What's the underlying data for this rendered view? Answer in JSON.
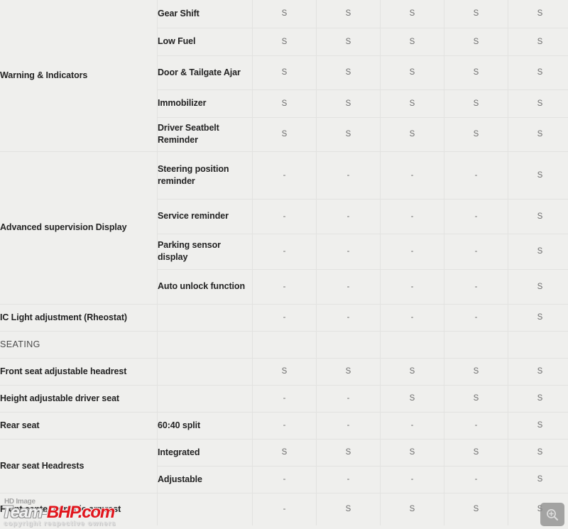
{
  "table": {
    "columns": [
      "feature-group",
      "feature-detail",
      "variant-1",
      "variant-2",
      "variant-3",
      "variant-4",
      "variant-5"
    ],
    "rows": [
      {
        "type": "data",
        "group": "Warning & Indicators",
        "group_rowspan": 5,
        "sub": "Gear Shift",
        "values": [
          "S",
          "S",
          "S",
          "S",
          "S"
        ]
      },
      {
        "type": "data",
        "group": null,
        "sub": "Low Fuel",
        "values": [
          "S",
          "S",
          "S",
          "S",
          "S"
        ]
      },
      {
        "type": "data",
        "group": null,
        "sub": "Door & Tailgate Ajar",
        "values": [
          "S",
          "S",
          "S",
          "S",
          "S"
        ]
      },
      {
        "type": "data",
        "group": null,
        "sub": "Immobilizer",
        "values": [
          "S",
          "S",
          "S",
          "S",
          "S"
        ]
      },
      {
        "type": "data",
        "group": null,
        "sub": "Driver Seatbelt Reminder",
        "values": [
          "S",
          "S",
          "S",
          "S",
          "S"
        ]
      },
      {
        "type": "data",
        "group": "Advanced supervision Display",
        "group_rowspan": 4,
        "sub": "Steering position reminder",
        "values": [
          "-",
          "-",
          "-",
          "-",
          "S"
        ]
      },
      {
        "type": "data",
        "group": null,
        "sub": "Service reminder",
        "values": [
          "-",
          "-",
          "-",
          "-",
          "S"
        ]
      },
      {
        "type": "data",
        "group": null,
        "sub": "Parking sensor display",
        "values": [
          "-",
          "-",
          "-",
          "-",
          "S"
        ]
      },
      {
        "type": "data",
        "group": null,
        "sub": "Auto unlock function",
        "values": [
          "-",
          "-",
          "-",
          "-",
          "S"
        ]
      },
      {
        "type": "data",
        "group": "IC Light adjustment (Rheostat)",
        "group_rowspan": 1,
        "sub": "",
        "values": [
          "-",
          "-",
          "-",
          "-",
          "S"
        ]
      },
      {
        "type": "section",
        "group": "SEATING",
        "sub": "",
        "values": [
          "",
          "",
          "",
          "",
          ""
        ]
      },
      {
        "type": "data",
        "group": "Front seat adjustable headrest",
        "group_rowspan": 1,
        "sub": "",
        "values": [
          "S",
          "S",
          "S",
          "S",
          "S"
        ]
      },
      {
        "type": "data",
        "group": "Height adjustable driver seat",
        "group_rowspan": 1,
        "sub": "",
        "values": [
          "-",
          "-",
          "S",
          "S",
          "S"
        ]
      },
      {
        "type": "data",
        "group": "Rear seat",
        "group_rowspan": 1,
        "sub": "60:40 split",
        "values": [
          "-",
          "-",
          "-",
          "-",
          "S"
        ]
      },
      {
        "type": "data",
        "group": "Rear seat Headrests",
        "group_rowspan": 2,
        "sub": "Integrated",
        "values": [
          "S",
          "S",
          "S",
          "S",
          "S"
        ]
      },
      {
        "type": "data",
        "group": null,
        "sub": "Adjustable",
        "values": [
          "-",
          "-",
          "-",
          "-",
          "S"
        ]
      },
      {
        "type": "data",
        "group": "Front center console armrest",
        "group_rowspan": 1,
        "sub": "",
        "values": [
          "-",
          "S",
          "S",
          "S",
          "S"
        ]
      }
    ]
  },
  "watermark": {
    "hd_label": "HD Image",
    "brand_first": "Team-",
    "brand_second": "BHP.com",
    "copyright": "copyright respective owners"
  },
  "controls": {
    "zoom_label": "zoom-in"
  },
  "colors": {
    "cell_background": "#efefed",
    "section_background": "#e4e4e2",
    "border": "#e2e2e0",
    "label_text": "#232323",
    "value_text": "#6d6d6d",
    "section_text": "#4a4a4a",
    "brand_red": "#e1151c",
    "zoom_button": "#8e8e8e"
  }
}
